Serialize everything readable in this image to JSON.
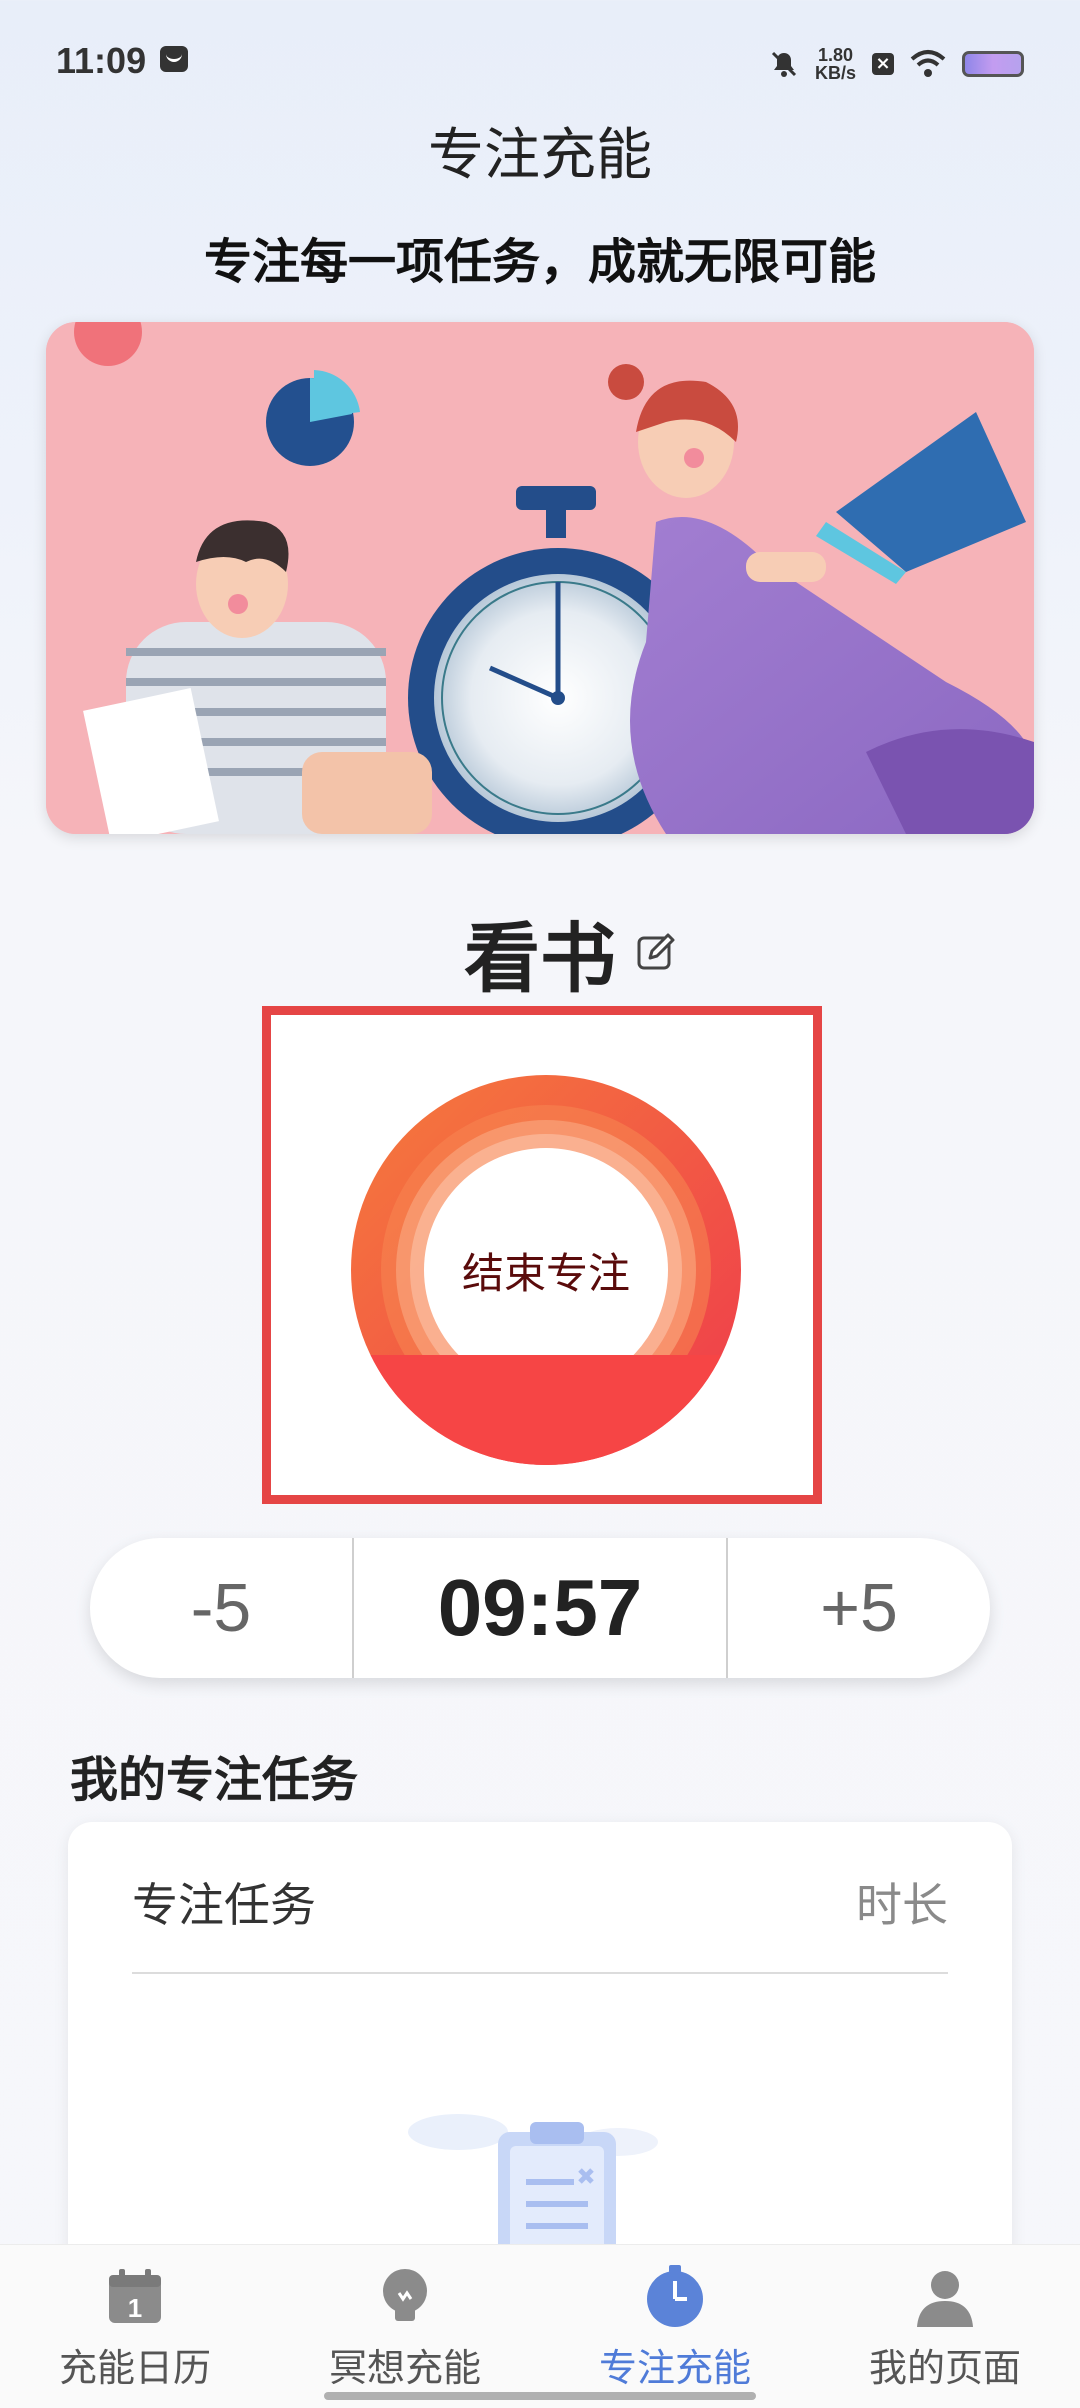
{
  "status_bar": {
    "time": "11:09",
    "net_speed_value": "1.80",
    "net_speed_unit": "KB/s",
    "x_badge": "×"
  },
  "header": {
    "title": "专注充能",
    "subtitle": "专注每一项任务，成就无限可能"
  },
  "banner": {
    "description_icon": "focus-illustration-icon"
  },
  "focus": {
    "task_name": "看书",
    "button_label": "结束专注",
    "timer": "09:57",
    "minus_label": "-5",
    "plus_label": "+5",
    "colors": {
      "ring_outer": "#f05a3c",
      "ring_fill": "#f64545",
      "frame": "#e54545"
    }
  },
  "tasks": {
    "section_title": "我的专注任务",
    "col_task": "专注任务",
    "col_duration": "时长"
  },
  "nav": {
    "items": [
      {
        "label": "充能日历",
        "icon": "calendar-icon"
      },
      {
        "label": "冥想充能",
        "icon": "lightbulb-icon"
      },
      {
        "label": "专注充能",
        "icon": "clock-icon",
        "active": true
      },
      {
        "label": "我的页面",
        "icon": "person-icon"
      }
    ],
    "accent": "#4f7bd8"
  }
}
